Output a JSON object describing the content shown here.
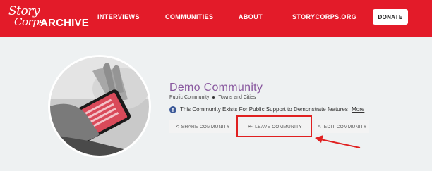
{
  "header": {
    "logo": {
      "line1": "Story",
      "line2": "Corps",
      "line3": "ARCHIVE"
    },
    "nav": [
      {
        "label": "INTERVIEWS"
      },
      {
        "label": "COMMUNITIES"
      },
      {
        "label": "ABOUT"
      },
      {
        "label": "STORYCORPS.ORG"
      }
    ],
    "donate_label": "DONATE"
  },
  "community": {
    "title": "Demo Community",
    "type": "Public Community",
    "category": "Towns and Cities",
    "social_icon": "facebook-icon",
    "description": "This Community Exists For Public Support to Demonstrate features",
    "more_label": "More"
  },
  "actions": {
    "share": {
      "label": "SHARE COMMUNITY",
      "icon": "share-icon"
    },
    "leave": {
      "label": "LEAVE COMMUNITY",
      "icon": "leave-icon"
    },
    "edit": {
      "label": "EDIT COMMUNITY",
      "icon": "edit-icon"
    }
  },
  "annotation": {
    "color": "#e02020"
  },
  "colors": {
    "brand": "#e31b29",
    "title": "#8a5aa0",
    "background": "#eef1f2"
  }
}
